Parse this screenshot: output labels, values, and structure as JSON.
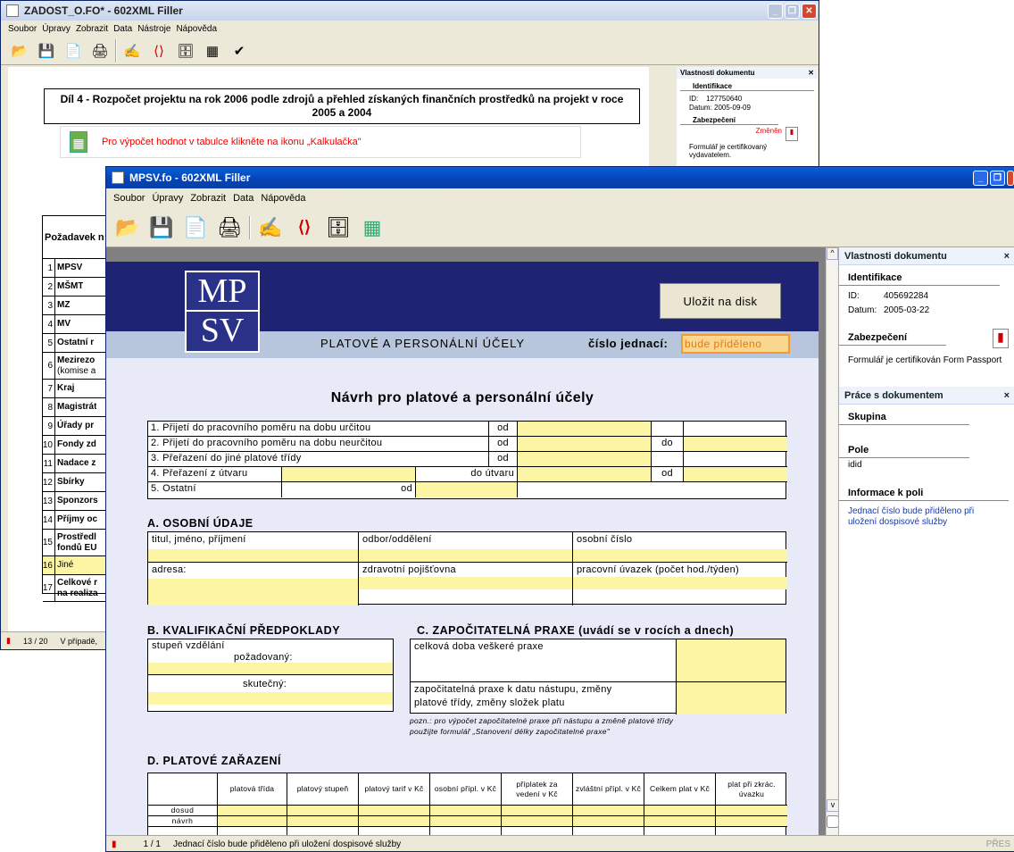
{
  "back_window": {
    "title": "ZADOST_O.FO* - 602XML Filler",
    "menu": [
      "Soubor",
      "Úpravy",
      "Zobrazit",
      "Data",
      "Nástroje",
      "Nápověda"
    ],
    "heading": "Díl 4 - Rozpočet projektu na rok 2006 podle zdrojů a přehled získaných finančních prostředků na projekt v roce 2005 a 2004",
    "calc_hint": "Pro výpočet hodnot v tabulce klikněte na ikonu „Kalkulačka\"",
    "table_header": "Požadavek n",
    "rows": [
      {
        "n": "1",
        "t": "MPSV"
      },
      {
        "n": "2",
        "t": "MŠMT"
      },
      {
        "n": "3",
        "t": "MZ"
      },
      {
        "n": "4",
        "t": "MV"
      },
      {
        "n": "5",
        "t": "Ostatní r"
      },
      {
        "n": "6",
        "t": "Mezirezo",
        "t2": "(komise a"
      },
      {
        "n": "7",
        "t": "Kraj"
      },
      {
        "n": "8",
        "t": "Magistrát"
      },
      {
        "n": "9",
        "t": "Úřady pr"
      },
      {
        "n": "10",
        "t": "Fondy zd"
      },
      {
        "n": "11",
        "t": "Nadace z"
      },
      {
        "n": "12",
        "t": "Sbírky"
      },
      {
        "n": "13",
        "t": "Sponzors"
      },
      {
        "n": "14",
        "t": "Příjmy oc"
      },
      {
        "n": "15",
        "t": "Prostředl",
        "t2": "fondů EU"
      },
      {
        "n": "16",
        "t": "Jiné"
      },
      {
        "n": "17",
        "t": "Celkové r",
        "t2": "na realiza"
      }
    ],
    "status_page": "13 / 20",
    "status_text": "V případě,",
    "panel": {
      "title": "Vlastnosti dokumentu",
      "ident": "Identifikace",
      "id_label": "ID:",
      "id_value": "127750640",
      "date_label": "Datum:",
      "date_value": "2005-09-09",
      "security": "Zabezpečení",
      "changed": "Změněn",
      "cert": "Formulář je certifikovaný vydavatelem."
    }
  },
  "front_window": {
    "title": "MPSV.fo - 602XML Filler",
    "menu": [
      "Soubor",
      "Úpravy",
      "Zobrazit",
      "Data",
      "Nápověda"
    ],
    "status_page": "1 / 1",
    "status_text": "Jednací číslo bude přiděleno při uložení dospisové služby",
    "status_right": "PŘES",
    "panel": {
      "title": "Vlastnosti dokumentu",
      "ident": "Identifikace",
      "id_label": "ID:",
      "id_value": "405692284",
      "date_label": "Datum:",
      "date_value": "2005-03-22",
      "security": "Zabezpečení",
      "cert": "Formulář je certifikován Form Passport",
      "work_title": "Práce s dokumentem",
      "group": "Skupina",
      "field": "Pole",
      "field_value": "idid",
      "info": "Informace k poli",
      "info_text": "Jednací číslo bude přiděleno při uložení dospisové služby"
    }
  },
  "form": {
    "logo_top": "MP",
    "logo_bottom": "SV",
    "save_button": "Uložit na disk",
    "banner": "PLATOVÉ A PERSONÁLNÍ ÚČELY",
    "ref_label": "číslo jednací:",
    "ref_value": "bude přiděleno",
    "title": "Návrh pro platové a personální účely",
    "options": {
      "o1": "1. Přijetí do pracovního poměru na dobu určitou",
      "o2": "2. Přijetí do pracovního poměru na dobu neurčitou",
      "o3": "3. Přeřazení do jiné platové třídy",
      "o4": "4. Přeřazení z útvaru",
      "o4b": "do útvaru",
      "o5": "5. Ostatní",
      "od": "od",
      "do": "do"
    },
    "secA": "A. OSOBNÍ ÚDAJE",
    "a": {
      "name": "titul, jméno, příjmení",
      "dept": "odbor/oddělení",
      "pid": "osobní číslo",
      "addr": "adresa:",
      "ins": "zdravotní pojišťovna",
      "work": "pracovní úvazek (počet hod./týden)"
    },
    "secB": "B. KVALIFIKAČNÍ PŘEDPOKLADY",
    "b": {
      "edu": "stupeň vzdělání",
      "req": "požadovaný:",
      "act": "skutečný:"
    },
    "secC": "C. ZAPOČITATELNÁ PRAXE (uvádí se v rocích a dnech)",
    "c": {
      "total": "celková doba veškeré praxe",
      "credit1": "započitatelná praxe k datu nástupu, změny",
      "credit2": "platové třídy, změny složek platu",
      "note1": "pozn.: pro výpočet započitatelné praxe při nástupu a změně platové třídy",
      "note2": "použijte formulář „Stanovení délky započitatelné praxe\""
    },
    "secD": "D. PLATOVÉ ZAŘAZENÍ",
    "d": {
      "cols": [
        "platová třída",
        "platový stupeň",
        "platový tarif v Kč",
        "osobní přípl. v Kč",
        "příplatek za vedení v Kč",
        "zvláštní přípl. v Kč",
        "Celkem plat v Kč",
        "plat při zkrác. úvazku"
      ],
      "rows": [
        "dosud",
        "návrh"
      ]
    }
  }
}
